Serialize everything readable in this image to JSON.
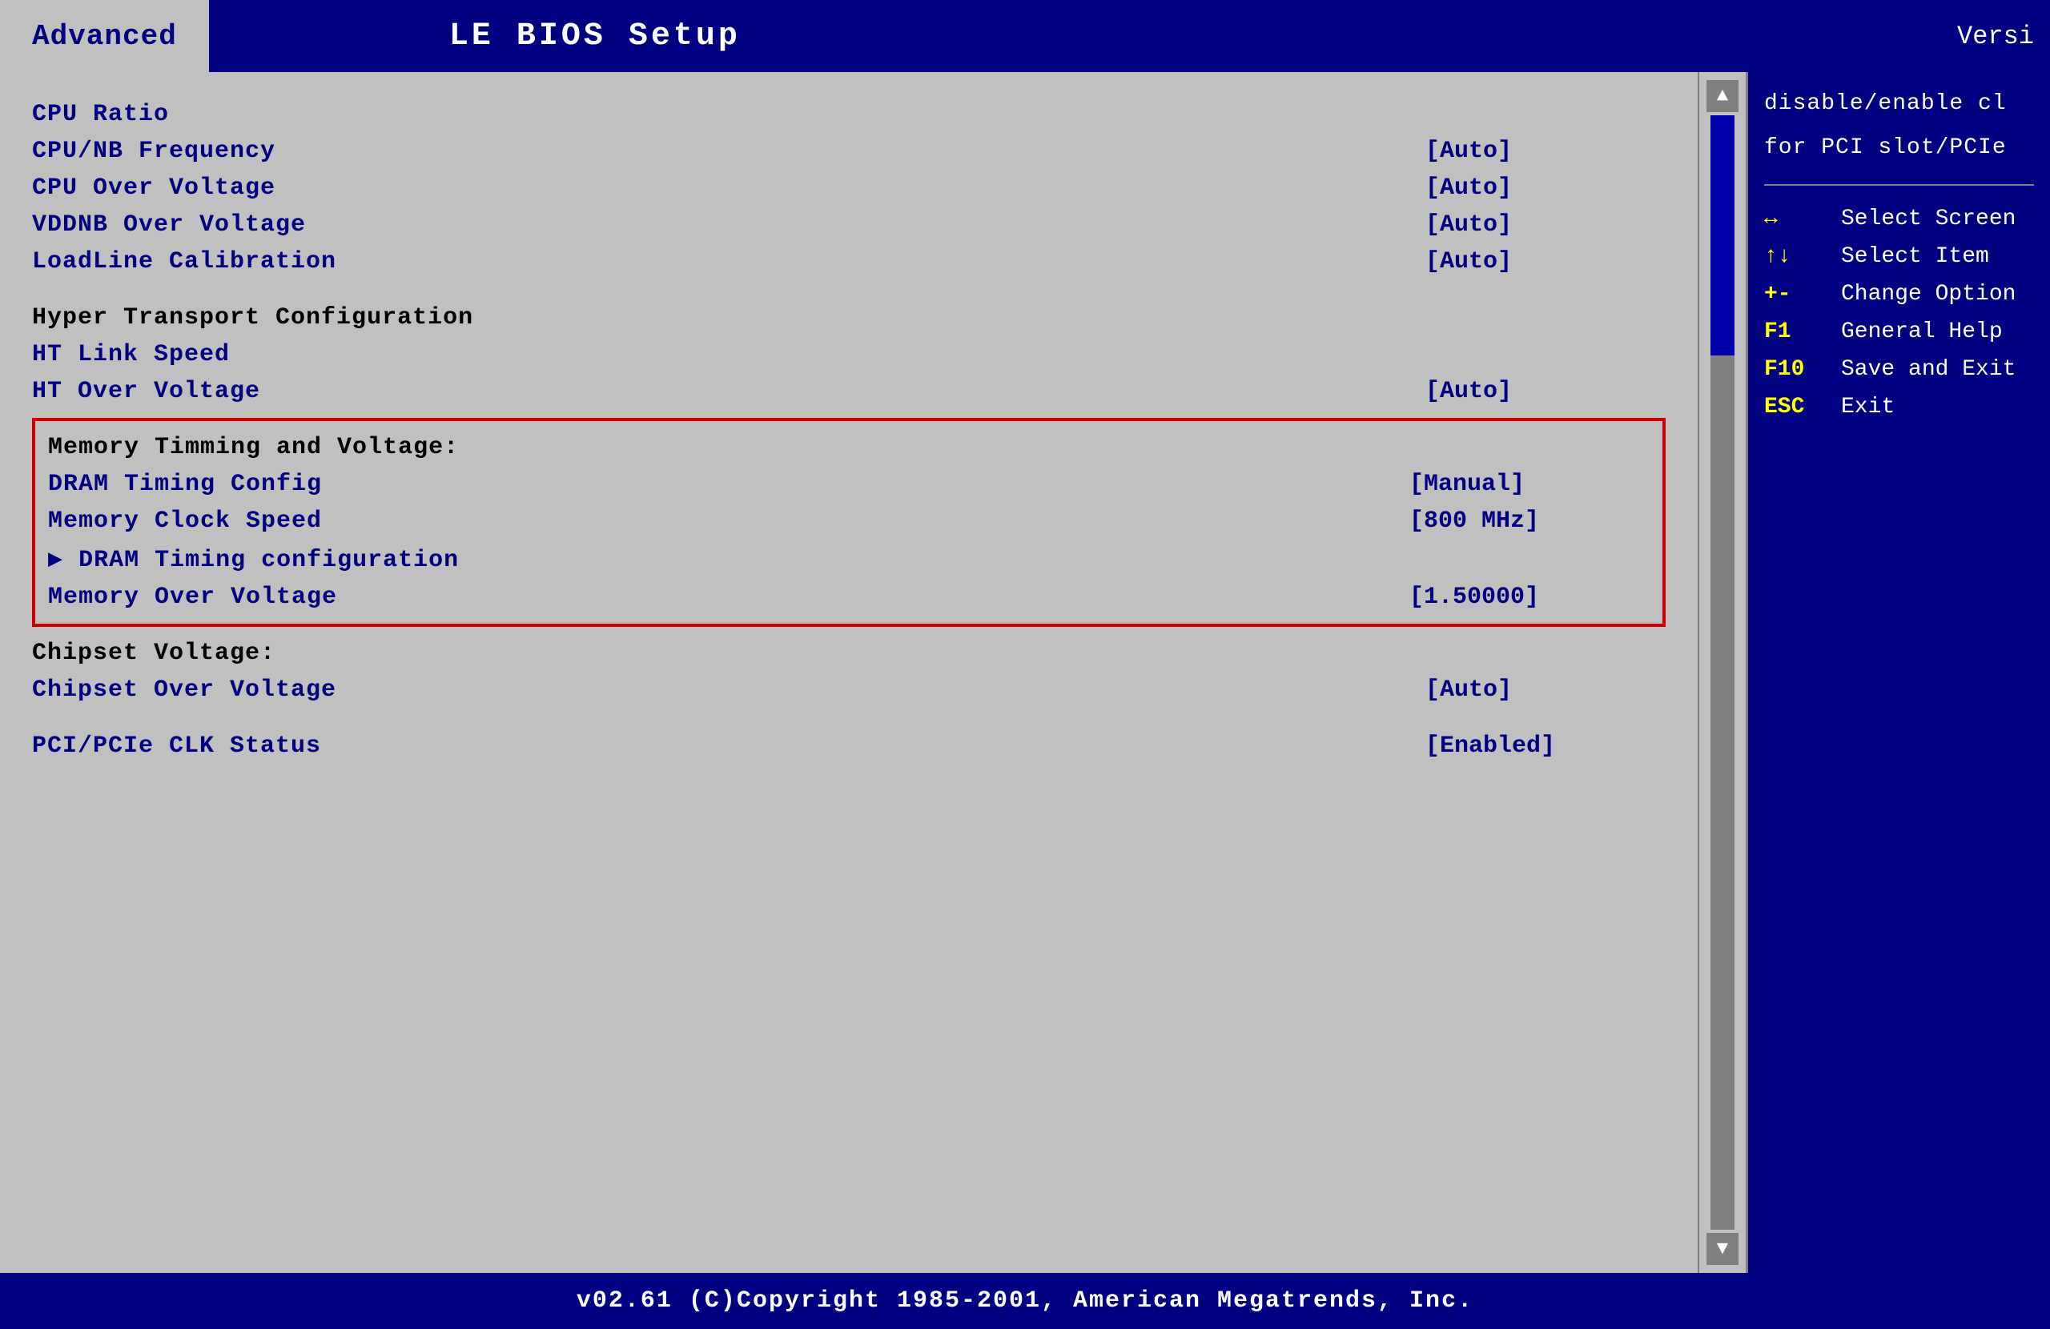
{
  "header": {
    "tab_label": "Advanced",
    "title": "LE BIOS Setup",
    "version_label": "Versi"
  },
  "menu": {
    "items": [
      {
        "label": "CPU Ratio",
        "value": ""
      },
      {
        "label": "CPU/NB Frequency",
        "value": "[Auto]"
      },
      {
        "label": "CPU Over Voltage",
        "value": "[Auto]"
      },
      {
        "label": "VDDNB Over Voltage",
        "value": "[Auto]"
      },
      {
        "label": "LoadLine Calibration",
        "value": "[Auto]"
      }
    ],
    "ht_section_header": "Hyper Transport Configuration",
    "ht_items": [
      {
        "label": "HT Link Speed",
        "value": ""
      },
      {
        "label": "HT Over Voltage",
        "value": "[Auto]"
      }
    ],
    "memory_section": {
      "header": "Memory Timming and Voltage:",
      "items": [
        {
          "label": "DRAM Timing Config",
          "value": "[Manual]"
        },
        {
          "label": "Memory Clock Speed",
          "value": "[800 MHz]"
        },
        {
          "label": "▶ DRAM Timing configuration",
          "value": ""
        },
        {
          "label": "Memory Over Voltage",
          "value": "[1.50000]"
        }
      ]
    },
    "chipset_section": {
      "header": "Chipset Voltage:",
      "items": [
        {
          "label": "Chipset Over Voltage",
          "value": "[Auto]"
        }
      ]
    },
    "pci_item": {
      "label": "PCI/PCIe CLK Status",
      "value": "[Enabled]"
    }
  },
  "help_panel": {
    "description_line1": "disable/enable cl",
    "description_line2": "for PCI slot/PCIe",
    "keys": [
      {
        "key": "↔",
        "desc": "Select Screen"
      },
      {
        "key": "↑↓",
        "desc": "Select Item"
      },
      {
        "key": "+-",
        "desc": "Change Option"
      },
      {
        "key": "F1",
        "desc": "General Help"
      },
      {
        "key": "F10",
        "desc": "Save and Exit"
      },
      {
        "key": "ESC",
        "desc": "Exit"
      }
    ]
  },
  "footer": {
    "text": "v02.61  (C)Copyright 1985-2001, American Megatrends, Inc."
  }
}
